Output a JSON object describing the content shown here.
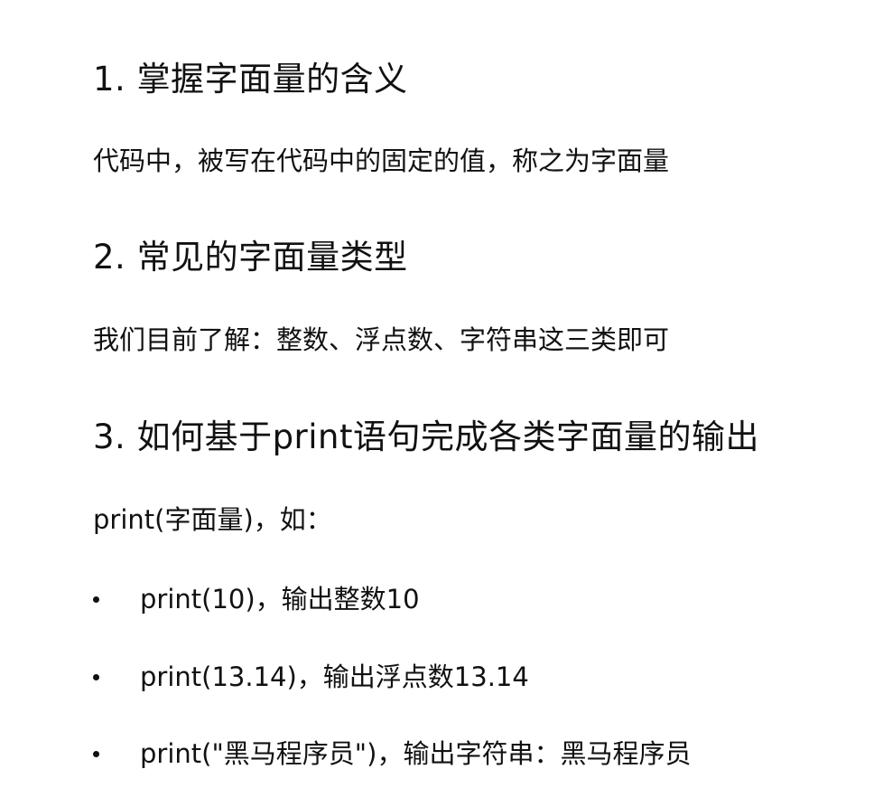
{
  "sections": [
    {
      "heading": "1. 掌握字面量的含义",
      "body": "代码中，被写在代码中的固定的值，称之为字面量"
    },
    {
      "heading": "2. 常见的字面量类型",
      "body": "我们目前了解：整数、浮点数、字符串这三类即可"
    },
    {
      "heading": "3. 如何基于print语句完成各类字面量的输出",
      "body": "print(字面量)，如：",
      "bullets": [
        "print(10)，输出整数10",
        "print(13.14)，输出浮点数13.14",
        "print(\"黑马程序员\")，输出字符串：黑马程序员"
      ]
    }
  ]
}
